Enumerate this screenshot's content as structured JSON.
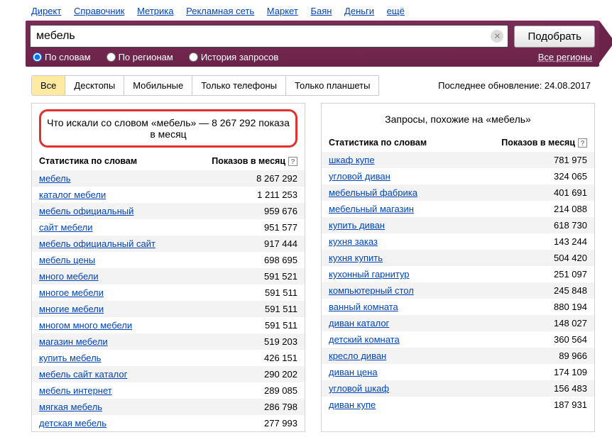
{
  "topnav": [
    "Директ",
    "Справочник",
    "Метрика",
    "Рекламная сеть",
    "Маркет",
    "Баян",
    "Деньги",
    "ещё"
  ],
  "search": {
    "value": "мебель",
    "button": "Подобрать",
    "radios": [
      "По словам",
      "По регионам",
      "История запросов"
    ],
    "regions": "Все регионы"
  },
  "tabs": [
    "Все",
    "Десктопы",
    "Мобильные",
    "Только телефоны",
    "Только планшеты"
  ],
  "last_update": "Последнее обновление: 24.08.2017",
  "left": {
    "title": "Что искали со словом «мебель» — 8 267 292 показа в месяц",
    "head_stat": "Статистика по словам",
    "head_count": "Показов в месяц",
    "rows": [
      {
        "q": "мебель",
        "n": "8 267 292"
      },
      {
        "q": "каталог мебели",
        "n": "1 211 253"
      },
      {
        "q": "мебель официальный",
        "n": "959 676"
      },
      {
        "q": "сайт мебели",
        "n": "951 577"
      },
      {
        "q": "мебель официальный сайт",
        "n": "917 444"
      },
      {
        "q": "мебель цены",
        "n": "698 695"
      },
      {
        "q": "много мебели",
        "n": "591 521"
      },
      {
        "q": "многое мебели",
        "n": "591 511"
      },
      {
        "q": "многие мебели",
        "n": "591 511"
      },
      {
        "q": "многом много мебели",
        "n": "591 511"
      },
      {
        "q": "магазин мебели",
        "n": "519 203"
      },
      {
        "q": "купить мебель",
        "n": "426 151"
      },
      {
        "q": "мебель сайт каталог",
        "n": "290 202"
      },
      {
        "q": "мебель интернет",
        "n": "289 085"
      },
      {
        "q": "мягкая мебель",
        "n": "286 798"
      },
      {
        "q": "детская мебель",
        "n": "277 993"
      }
    ]
  },
  "right": {
    "title": "Запросы, похожие на «мебель»",
    "head_stat": "Статистика по словам",
    "head_count": "Показов в месяц",
    "rows": [
      {
        "q": "шкаф купе",
        "n": "781 975"
      },
      {
        "q": "угловой диван",
        "n": "324 065"
      },
      {
        "q": "мебельный фабрика",
        "n": "401 691"
      },
      {
        "q": "мебельный магазин",
        "n": "214 088"
      },
      {
        "q": "купить диван",
        "n": "618 730"
      },
      {
        "q": "кухня заказ",
        "n": "143 244"
      },
      {
        "q": "кухня купить",
        "n": "504 420"
      },
      {
        "q": "кухонный гарнитур",
        "n": "251 097"
      },
      {
        "q": "компьютерный стол",
        "n": "245 848"
      },
      {
        "q": "ванный комната",
        "n": "880 194"
      },
      {
        "q": "диван каталог",
        "n": "148 027"
      },
      {
        "q": "детский комната",
        "n": "360 564"
      },
      {
        "q": "кресло диван",
        "n": "89 966"
      },
      {
        "q": "диван цена",
        "n": "174 109"
      },
      {
        "q": "угловой шкаф",
        "n": "156 483"
      },
      {
        "q": "диван купе",
        "n": "187 931"
      }
    ]
  }
}
